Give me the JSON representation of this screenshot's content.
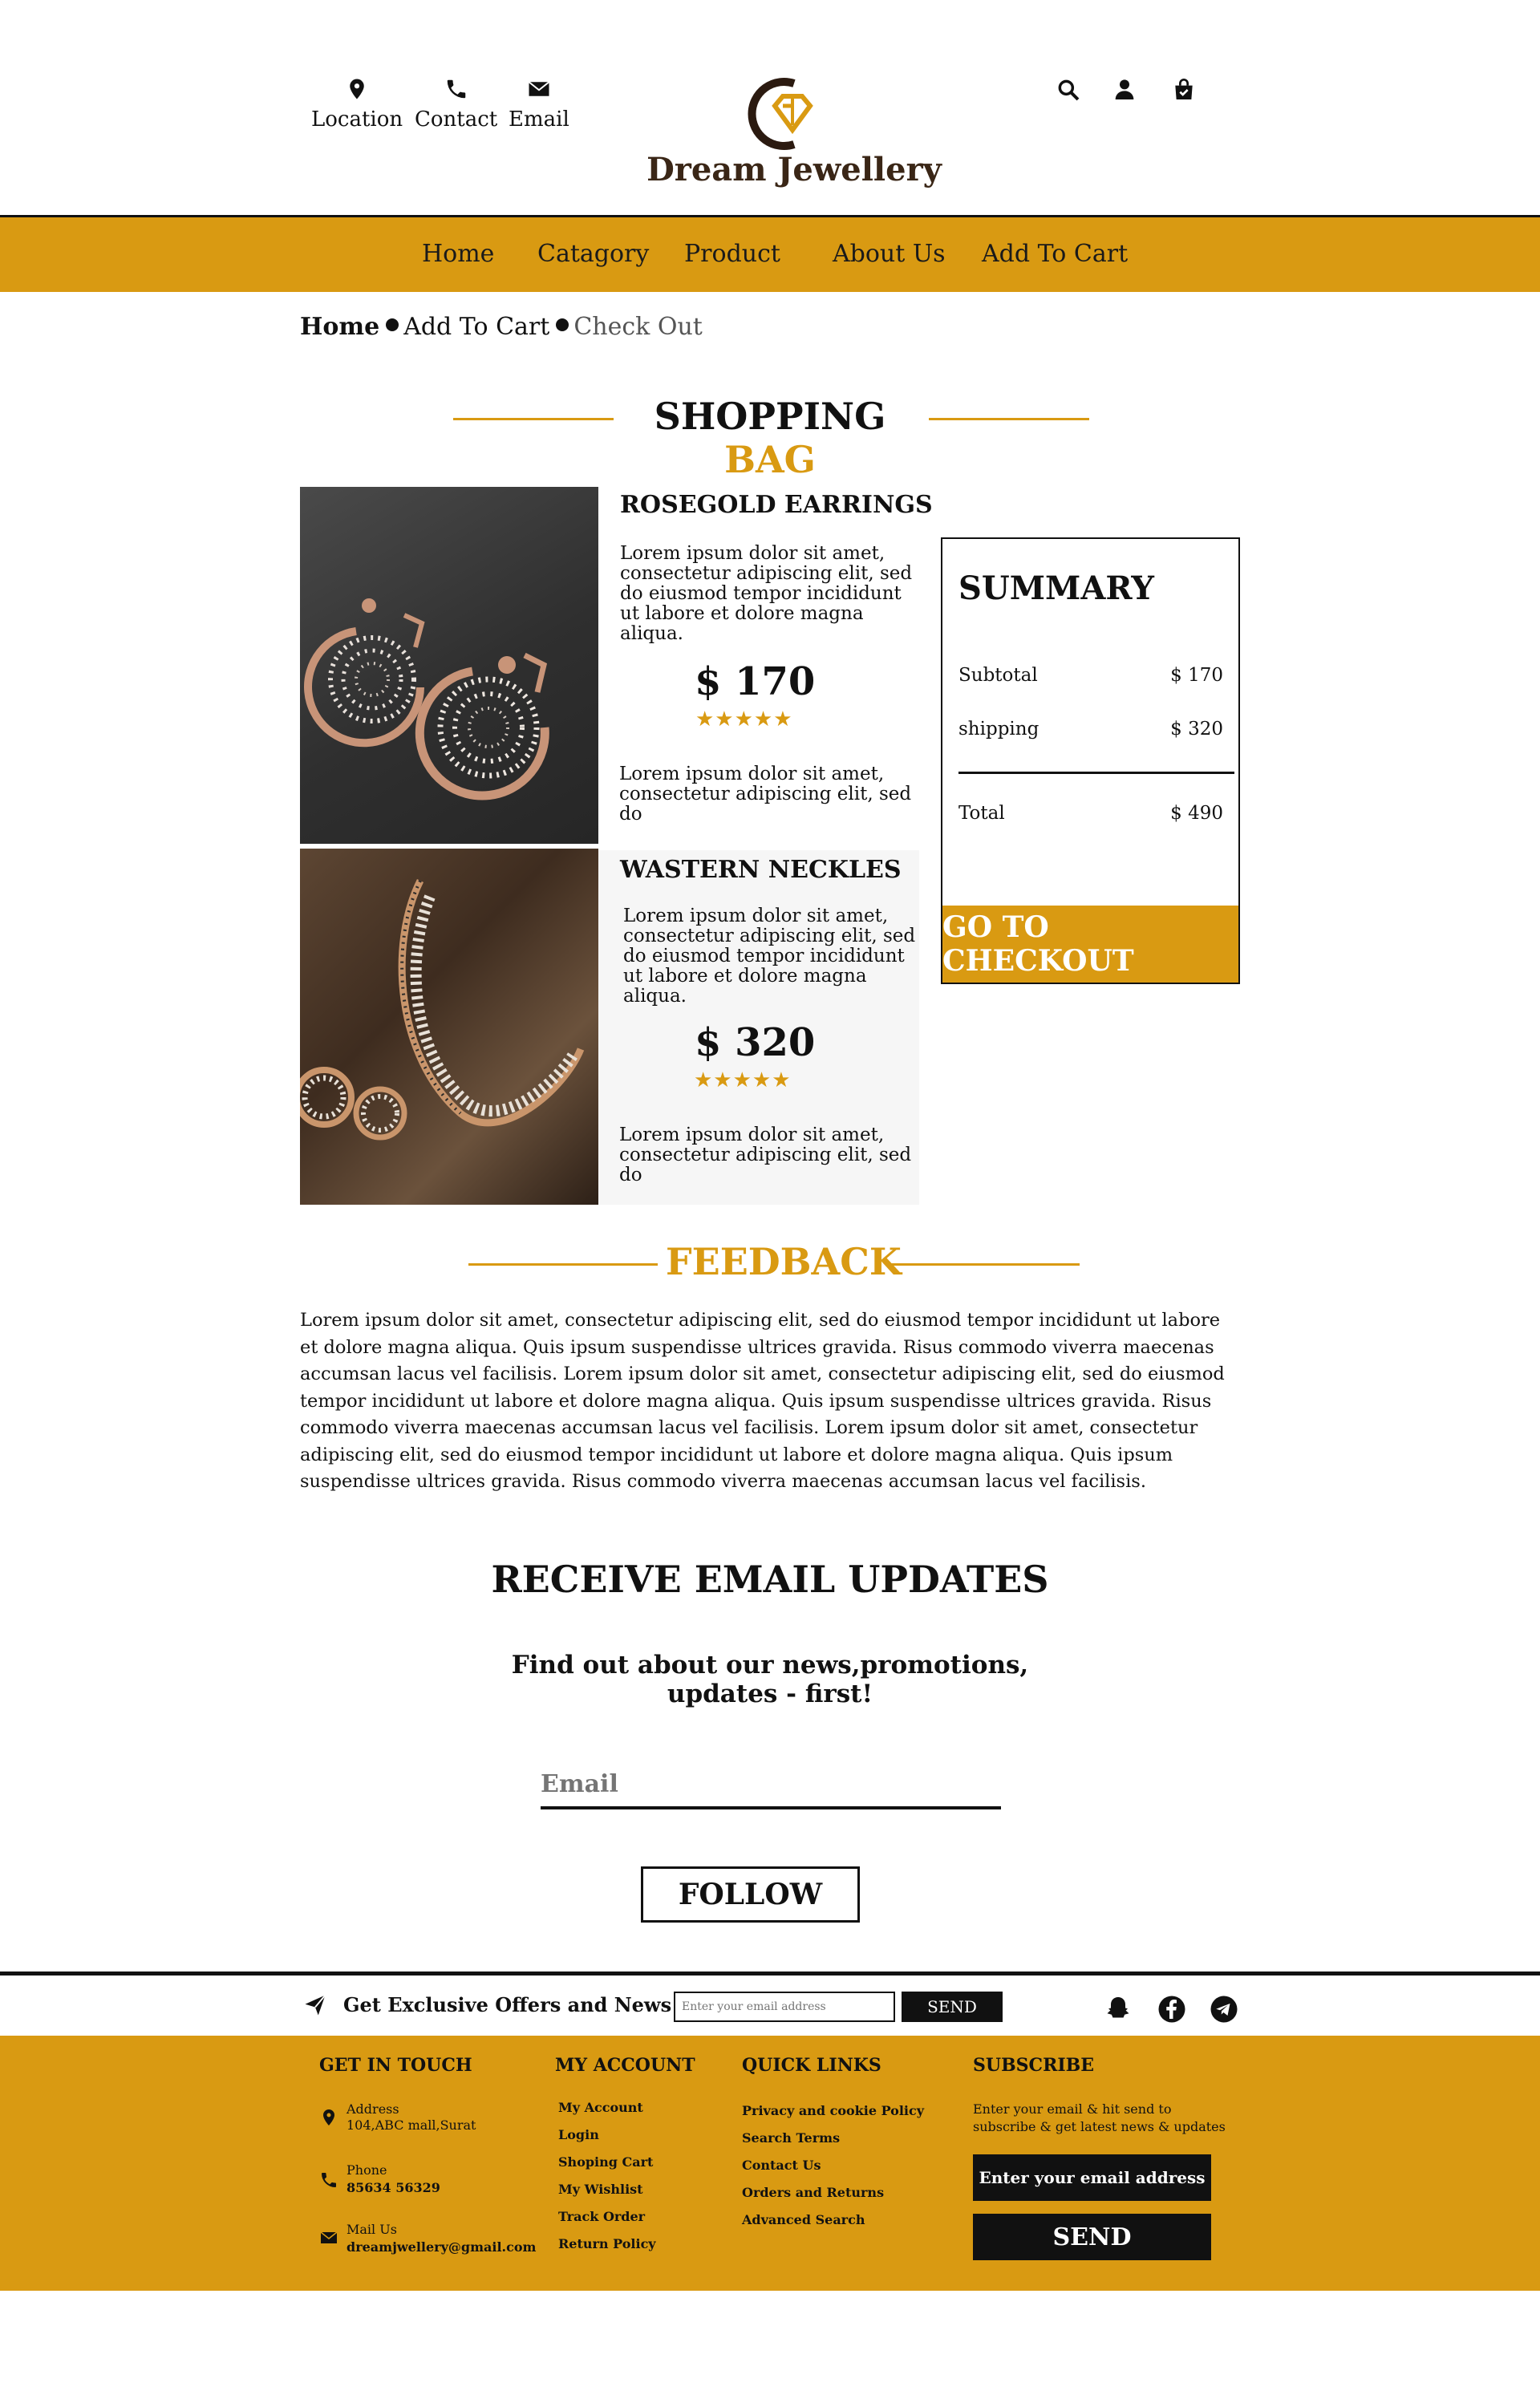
{
  "brand": {
    "name": "Dream Jewellery",
    "accent": "#d99a12"
  },
  "header": {
    "links": [
      {
        "label": "Location",
        "icon": "map-pin-icon"
      },
      {
        "label": "Contact",
        "icon": "phone-icon"
      },
      {
        "label": "Email",
        "icon": "envelope-icon"
      }
    ],
    "right_icons": [
      "search-icon",
      "user-icon",
      "shopping-bag-icon"
    ]
  },
  "nav": {
    "items": [
      "Home",
      "Catagory",
      "Product",
      "About Us",
      "Add To Cart"
    ]
  },
  "breadcrumb": {
    "items": [
      "Home",
      "Add To Cart",
      "Check Out"
    ]
  },
  "shopping_bag": {
    "title_part1": "SHOPPING",
    "title_part2": "BAG",
    "products": [
      {
        "name": "ROSEGOLD EARRINGS",
        "desc": "Lorem ipsum dolor sit amet, consectetur adipiscing elit, sed do eiusmod tempor incididunt ut labore et dolore magna aliqua.",
        "price": "$ 170",
        "rating": 5,
        "stars": "★★★★★",
        "desc2": "Lorem ipsum dolor sit amet, consectetur adipiscing elit, sed do"
      },
      {
        "name": "WASTERN NECKLES",
        "desc": "Lorem ipsum dolor sit amet, consectetur adipiscing elit, sed do eiusmod tempor incididunt ut labore et dolore magna aliqua.",
        "price": "$ 320",
        "rating": 5,
        "stars": "★★★★★",
        "desc2": "Lorem ipsum dolor sit amet, consectetur adipiscing elit, sed do"
      }
    ]
  },
  "summary": {
    "title": "SUMMARY",
    "subtotal_label": "Subtotal",
    "subtotal_value": "$ 170",
    "shipping_label": "shipping",
    "shipping_value": "$ 320",
    "total_label": "Total",
    "total_value": "$ 490",
    "checkout_label": "GO TO CHECKOUT"
  },
  "feedback": {
    "title": "FEEDBACK",
    "text": "Lorem ipsum dolor sit amet, consectetur adipiscing elit, sed do eiusmod tempor incididunt ut labore et dolore magna aliqua. Quis ipsum suspendisse ultrices gravida. Risus commodo viverra maecenas accumsan lacus vel facilisis. Lorem ipsum dolor sit amet, consectetur adipiscing elit, sed do eiusmod tempor incididunt ut labore et dolore magna aliqua. Quis ipsum suspendisse ultrices gravida. Risus commodo viverra maecenas accumsan lacus vel facilisis. Lorem ipsum dolor sit amet, consectetur adipiscing elit, sed do eiusmod tempor incididunt ut labore et dolore magna aliqua. Quis ipsum suspendisse ultrices gravida. Risus commodo viverra maecenas accumsan lacus vel facilisis."
  },
  "email_updates": {
    "title": "RECEIVE EMAIL UPDATES",
    "subtitle_line1": "Find out about our news,promotions,",
    "subtitle_line2": "updates - first!",
    "email_placeholder": "Email",
    "follow_label": "FOLLOW"
  },
  "offer_bar": {
    "text": "Get Exclusive Offers and News",
    "input_placeholder": "Enter your email address",
    "send_label": "SEND",
    "social_icons": [
      "snapchat-icon",
      "facebook-icon",
      "telegram-icon"
    ]
  },
  "footer": {
    "get_in_touch": {
      "title": "GET IN TOUCH",
      "address_label": "Address",
      "address_value": "104,ABC mall,Surat",
      "phone_label": "Phone",
      "phone_value": "85634 56329",
      "mail_label": "Mail Us",
      "mail_value": "dreamjwellery@gmail.com"
    },
    "my_account": {
      "title": "MY ACCOUNT",
      "links": [
        "My Account",
        "Login",
        "Shoping Cart",
        "My Wishlist",
        "Track Order",
        "Return Policy"
      ]
    },
    "quick_links": {
      "title": "QUICK LINKS",
      "links": [
        "Privacy and cookie Policy",
        "Search Terms",
        "Contact Us",
        "Orders and Returns",
        "Advanced Search"
      ]
    },
    "subscribe": {
      "title": "SUBSCRIBE",
      "text_line1": "Enter your email & hit send to",
      "text_line2": "subscribe & get latest news & updates",
      "input_placeholder": "Enter your email address",
      "send_label": "SEND"
    }
  }
}
